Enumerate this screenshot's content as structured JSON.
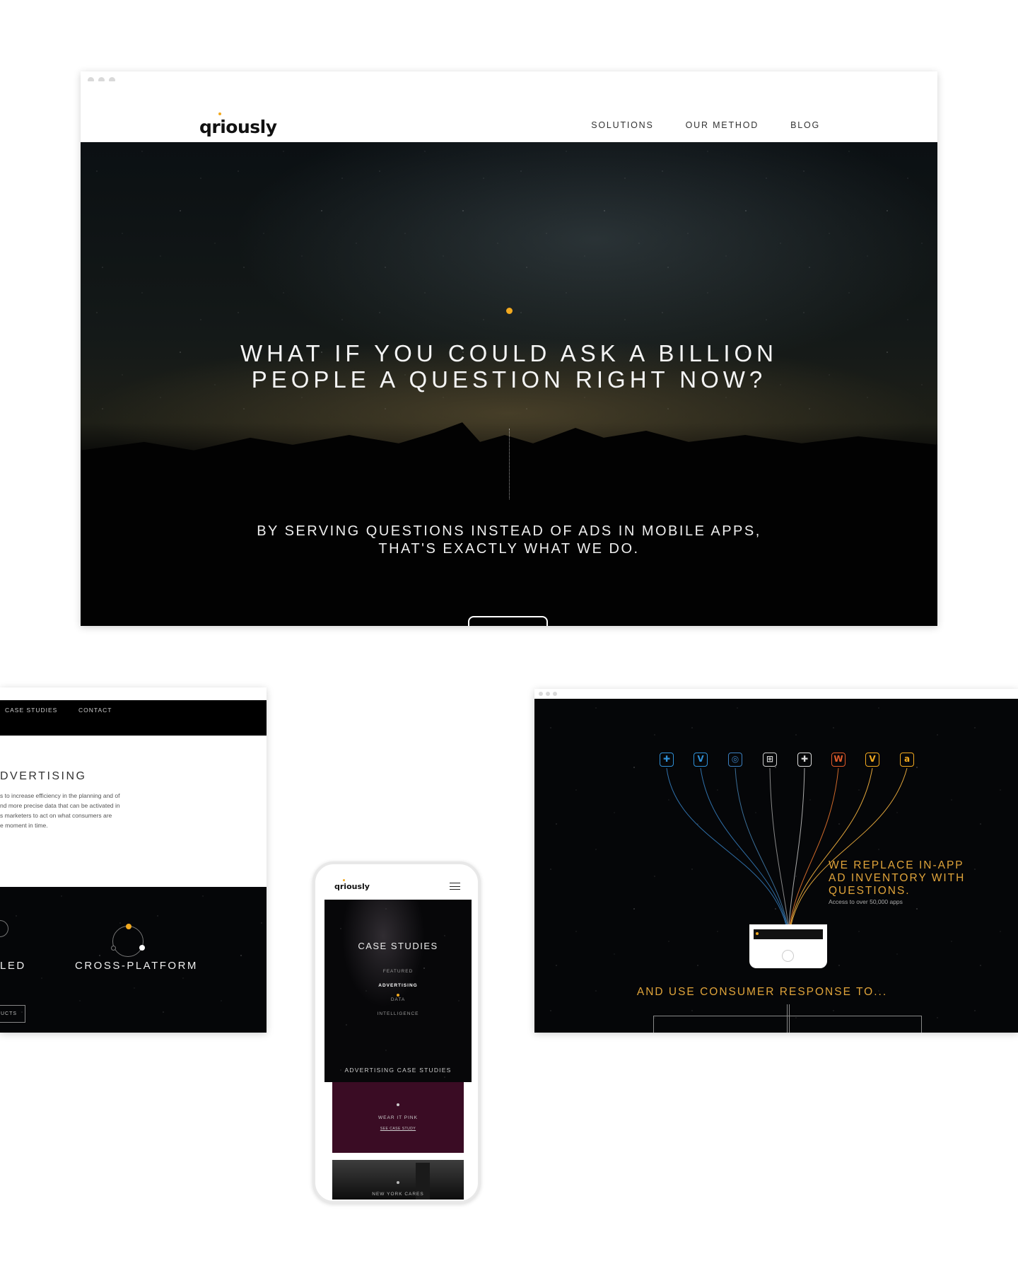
{
  "main_window": {
    "logo": "qriously",
    "nav": [
      "SOLUTIONS",
      "OUR METHOD",
      "BLOG"
    ],
    "hero": {
      "title_lines": [
        "WHAT IF YOU COULD ASK A BILLION",
        "PEOPLE A QUESTION RIGHT NOW?"
      ],
      "subtitle_lines": [
        "BY SERVING QUESTIONS INSTEAD OF ADS IN MOBILE APPS,",
        "THAT'S EXACTLY WHAT WE DO."
      ]
    }
  },
  "left_window": {
    "nav": [
      "CASE STUDIES",
      "CONTACT"
    ],
    "heading": "DVERTISING",
    "paragraph_lines": [
      "s to increase efficiency in the planning and of",
      "nd more precise data that can be activated in",
      "s marketers to act on what consumers are",
      "e moment in time."
    ],
    "feature_left": "LED",
    "feature_cross": "CROSS-PLATFORM",
    "button": "UCTS"
  },
  "phone": {
    "logo": "qriously",
    "title": "CASE STUDIES",
    "categories": [
      "FEATURED",
      "ADVERTISING",
      "DATA",
      "INTELLIGENCE"
    ],
    "active_category": "ADVERTISING",
    "section_title": "ADVERTISING CASE STUDIES",
    "card1": {
      "title": "WEAR IT PINK",
      "link": "SEE CASE STUDY",
      "color": "#3a0c24"
    },
    "card2": {
      "title": "NEW YORK CARES"
    }
  },
  "right_window": {
    "app_icons": [
      {
        "glyph": "✚",
        "color": "#2f8fd6",
        "name": "plus-app-icon"
      },
      {
        "glyph": "V",
        "color": "#2f8fd6",
        "name": "vimeo-app-icon"
      },
      {
        "glyph": "◎",
        "color": "#3b7fbf",
        "name": "camera-app-icon"
      },
      {
        "glyph": "⊞",
        "color": "#cccccc",
        "name": "grid-app-icon"
      },
      {
        "glyph": "✚",
        "color": "#dddddd",
        "name": "clover-app-icon"
      },
      {
        "glyph": "W",
        "color": "#e05a2a",
        "name": "words-app-icon"
      },
      {
        "glyph": "V",
        "color": "#f2a91f",
        "name": "venmo-app-icon"
      },
      {
        "glyph": "a",
        "color": "#f2a91f",
        "name": "alpha-app-icon"
      }
    ],
    "headline_lines": [
      "WE REPLACE IN-APP",
      "AD INVENTORY WITH",
      "QUESTIONS."
    ],
    "access": "Access to over 50,000 apps",
    "consumer": "AND USE CONSUMER RESPONSE TO..."
  },
  "colors": {
    "accent": "#f2a91f",
    "gold_text": "#e0a43a"
  }
}
